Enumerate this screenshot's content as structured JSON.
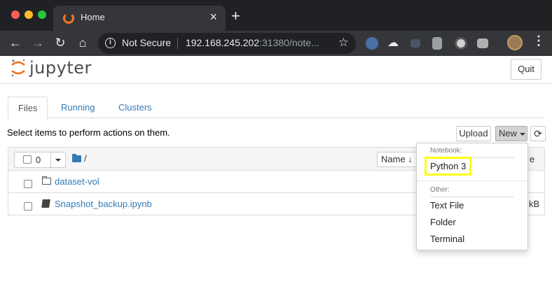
{
  "browser": {
    "tab_title": "Home",
    "security_label": "Not Secure",
    "url_host": "192.168.245.202",
    "url_rest": ":31380/note..."
  },
  "jupyter": {
    "logo_text": "jupyter",
    "quit_label": "Quit",
    "tabs": [
      {
        "label": "Files"
      },
      {
        "label": "Running"
      },
      {
        "label": "Clusters"
      }
    ],
    "select_info": "Select items to perform actions on them.",
    "upload_label": "Upload",
    "new_label": "New",
    "refresh_icon": "refresh-icon",
    "list_header": {
      "selected_count": "0",
      "breadcrumb": "/",
      "sort_label": "Name",
      "partial_header": "e"
    },
    "items": [
      {
        "name": "dataset-vol",
        "type": "folder",
        "size": ""
      },
      {
        "name": "Snapshot_backup.ipynb",
        "type": "notebook",
        "size": "kB"
      }
    ]
  },
  "new_menu": {
    "notebook_header": "Notebook:",
    "notebook_items": [
      "Python 3"
    ],
    "other_header": "Other:",
    "other_items": [
      "Text File",
      "Folder",
      "Terminal"
    ],
    "highlight_color": "#ffff1a"
  }
}
